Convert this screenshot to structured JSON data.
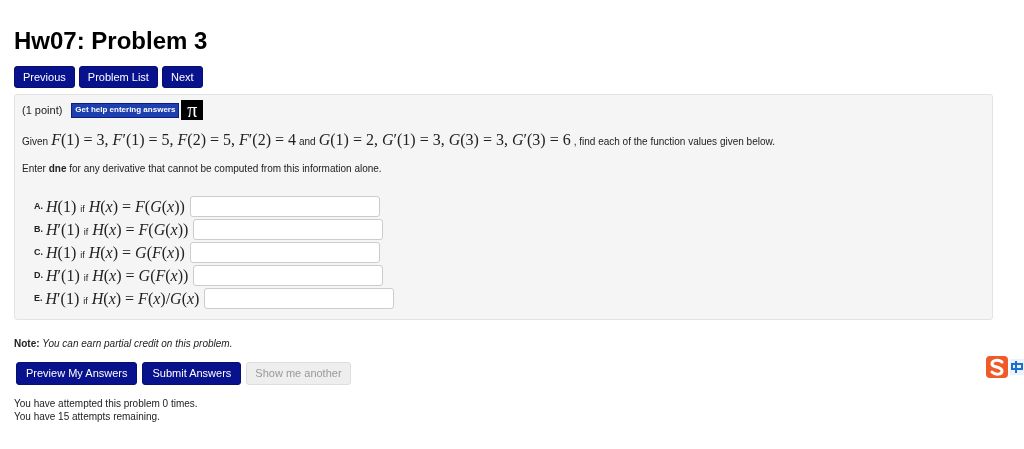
{
  "title": "Hw07: Problem 3",
  "nav_buttons": [
    "Previous",
    "Problem List",
    "Next"
  ],
  "problem": {
    "points": "(1 point)",
    "help_button": "Get help entering answers",
    "equation_editor_button": "π",
    "given": [
      {
        "kind": "text",
        "s": "Given"
      },
      {
        "kind": "math",
        "s": "*F*(1) = 3, *F*′(1) = 5, *F*(2) = 5, *F*′(2) = 4"
      },
      {
        "kind": "text",
        "s": "and"
      },
      {
        "kind": "math",
        "s": "*G*(1) = 2, *G*′(1) = 3, *G*(3) = 3, *G*′(3) = 6"
      },
      {
        "kind": "text",
        "s": ", find each of the function values given below."
      }
    ],
    "instruction": "Enter **dne** for any derivative that cannot be computed from this information alone.",
    "parts": [
      {
        "label": "A.",
        "target": "*H*(1)",
        "word": "if",
        "condition": "*H*(*x*) = *F*(*G*(*x*))"
      },
      {
        "label": "B.",
        "target": "*H*′(1)",
        "word": "if",
        "condition": "*H*(*x*) = *F*(*G*(*x*))"
      },
      {
        "label": "C.",
        "target": "*H*(1)",
        "word": "if",
        "condition": "*H*(*x*) = *G*(*F*(*x*))"
      },
      {
        "label": "D.",
        "target": "*H*′(1)",
        "word": "if",
        "condition": "*H*(*x*) = *G*(*F*(*x*))"
      },
      {
        "label": "E.",
        "target": "*H*′(1)",
        "word": "if",
        "condition": "*H*(*x*) = *F*(*x*)/*G*(*x*)"
      }
    ]
  },
  "note": {
    "label": "Note:",
    "text": "You can earn partial credit on this problem."
  },
  "action_buttons": [
    {
      "label": "Preview My Answers",
      "disabled": false
    },
    {
      "label": "Submit Answers",
      "disabled": false
    },
    {
      "label": "Show me another",
      "disabled": true
    }
  ],
  "attempts": [
    "You have attempted this problem 0 times.",
    "You have 15 attempts remaining."
  ]
}
